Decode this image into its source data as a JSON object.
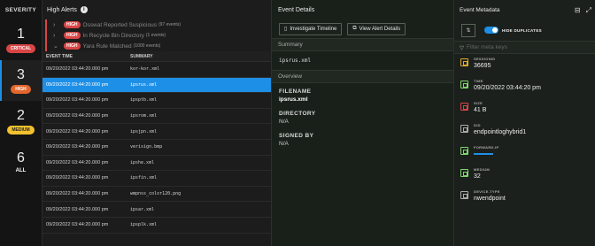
{
  "severity": {
    "header": "SEVERITY",
    "items": [
      {
        "count": "1",
        "label": "CRITICAL",
        "color": "#d94545",
        "text": "#ffffff"
      },
      {
        "count": "3",
        "label": "HIGH",
        "color": "#e4662b",
        "text": "#ffffff"
      },
      {
        "count": "2",
        "label": "MEDIUM",
        "color": "#f2c12e",
        "text": "#222222"
      },
      {
        "count": "6",
        "label": "ALL",
        "color": "",
        "text": "#ffffff"
      }
    ]
  },
  "alerts": {
    "title": "High Alerts",
    "info_icon": "info-icon",
    "groups": [
      {
        "badge": "HIGH",
        "name": "Osswat Reported Suspicious",
        "count": "(97 events)",
        "expanded": false
      },
      {
        "badge": "HIGH",
        "name": "In Recycle Bin Directory",
        "count": "(1 events)",
        "expanded": false
      },
      {
        "badge": "HIGH",
        "name": "Yara Rule Matched",
        "count": "(1000 events)",
        "expanded": true
      }
    ],
    "columns": {
      "time": "EVENT TIME",
      "summary": "SUMMARY"
    },
    "rows": [
      {
        "time": "09/20/2022 03:44:20.000 pm",
        "summary": "kor-kor.xml"
      },
      {
        "time": "09/20/2022 03:44:20.000 pm",
        "summary": "ipsrus.xml"
      },
      {
        "time": "09/20/2022 03:44:20.000 pm",
        "summary": "ipsptb.xml"
      },
      {
        "time": "09/20/2022 03:44:20.000 pm",
        "summary": "ipsrom.xml"
      },
      {
        "time": "09/20/2022 03:44:20.000 pm",
        "summary": "ipsjpn.xml"
      },
      {
        "time": "09/20/2022 03:44:20.000 pm",
        "summary": "verisign.bmp"
      },
      {
        "time": "09/20/2022 03:44:20.000 pm",
        "summary": "ipshe.xml"
      },
      {
        "time": "09/20/2022 03:44:20.000 pm",
        "summary": "ipsfin.xml"
      },
      {
        "time": "09/20/2022 03:44:20.000 pm",
        "summary": "wmpnss_color120.png"
      },
      {
        "time": "09/20/2022 03:44:20.000 pm",
        "summary": "ipsar.xml"
      },
      {
        "time": "09/20/2022 03:44:20.000 pm",
        "summary": "ipsplk.xml"
      }
    ],
    "selected_index": 1
  },
  "details": {
    "title": "Event Details",
    "investigate_label": "Investigate Timeline",
    "view_alert_label": "View Alert Details",
    "summary_header": "Summary",
    "summary_value": "ipsrus.xml",
    "overview_header": "Overview",
    "fields": [
      {
        "label": "FILENAME",
        "value": "ipsrus.xml"
      },
      {
        "label": "DIRECTORY",
        "value": "N/A"
      },
      {
        "label": "SIGNED BY",
        "value": "N/A"
      }
    ]
  },
  "metadata": {
    "title": "Event Metadata",
    "toggle_label": "HIDE DUPLICATES",
    "filter_placeholder": "Filter meta keys",
    "items": [
      {
        "key": "SESSIONID",
        "value": "36695",
        "icon": "session-icon",
        "tone": "warn"
      },
      {
        "key": "TIME",
        "value": "09/20/2022 03:44:20 pm",
        "icon": "clock-icon",
        "tone": ""
      },
      {
        "key": "SIZE",
        "value": "41 B",
        "icon": "size-icon",
        "tone": "red"
      },
      {
        "key": "DID",
        "value": "endpointloghybrid1",
        "icon": "database-icon",
        "tone": "gray"
      },
      {
        "key": "FORWARD.IP",
        "value": "",
        "icon": "network-icon",
        "tone": ""
      },
      {
        "key": "MEDIUM",
        "value": "32",
        "icon": "medium-icon",
        "tone": ""
      },
      {
        "key": "DEVICE.TYPE",
        "value": "nwendpoint",
        "icon": "device-icon",
        "tone": "gray"
      }
    ]
  }
}
